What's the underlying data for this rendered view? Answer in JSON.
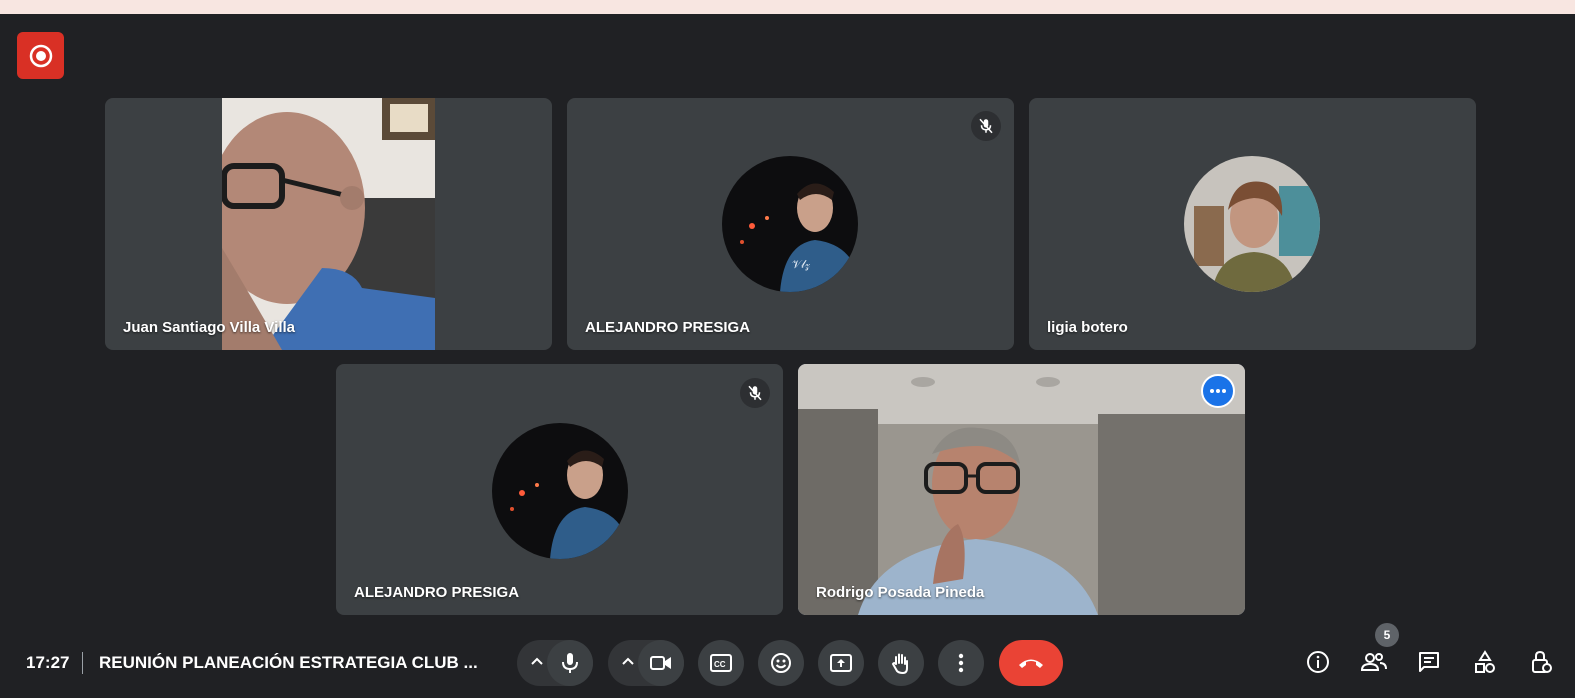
{
  "meeting": {
    "time": "17:27",
    "title": "REUNIÓN PLANEACIÓN ESTRATEGIA CLUB ..."
  },
  "participants": [
    {
      "name": "Juan Santiago Villa Villa",
      "muted": false,
      "video": true
    },
    {
      "name": "ALEJANDRO PRESIGA",
      "muted": true,
      "video": false
    },
    {
      "name": "ligia botero",
      "muted": false,
      "video": false
    },
    {
      "name": "ALEJANDRO PRESIGA",
      "muted": true,
      "video": false
    },
    {
      "name": "Rodrigo Posada Pineda",
      "muted": false,
      "video": true,
      "selected": true
    }
  ],
  "people_count": "5",
  "icons": {
    "record": "record-icon",
    "mic": "microphone-icon",
    "camera": "camera-icon",
    "captions": "closed-captions-icon",
    "reactions": "emoji-icon",
    "present": "present-screen-icon",
    "hand": "raise-hand-icon",
    "more": "more-options-icon",
    "end": "end-call-icon",
    "info": "meeting-details-icon",
    "people": "people-icon",
    "chat": "chat-icon",
    "activities": "activities-icon",
    "host": "host-controls-icon"
  },
  "colors": {
    "background": "#202124",
    "tile": "#3c4043",
    "record_red": "#d93025",
    "end_call_red": "#ea4335",
    "selected_outline": "#8ab4f8",
    "more_blue": "#1a73e8"
  }
}
